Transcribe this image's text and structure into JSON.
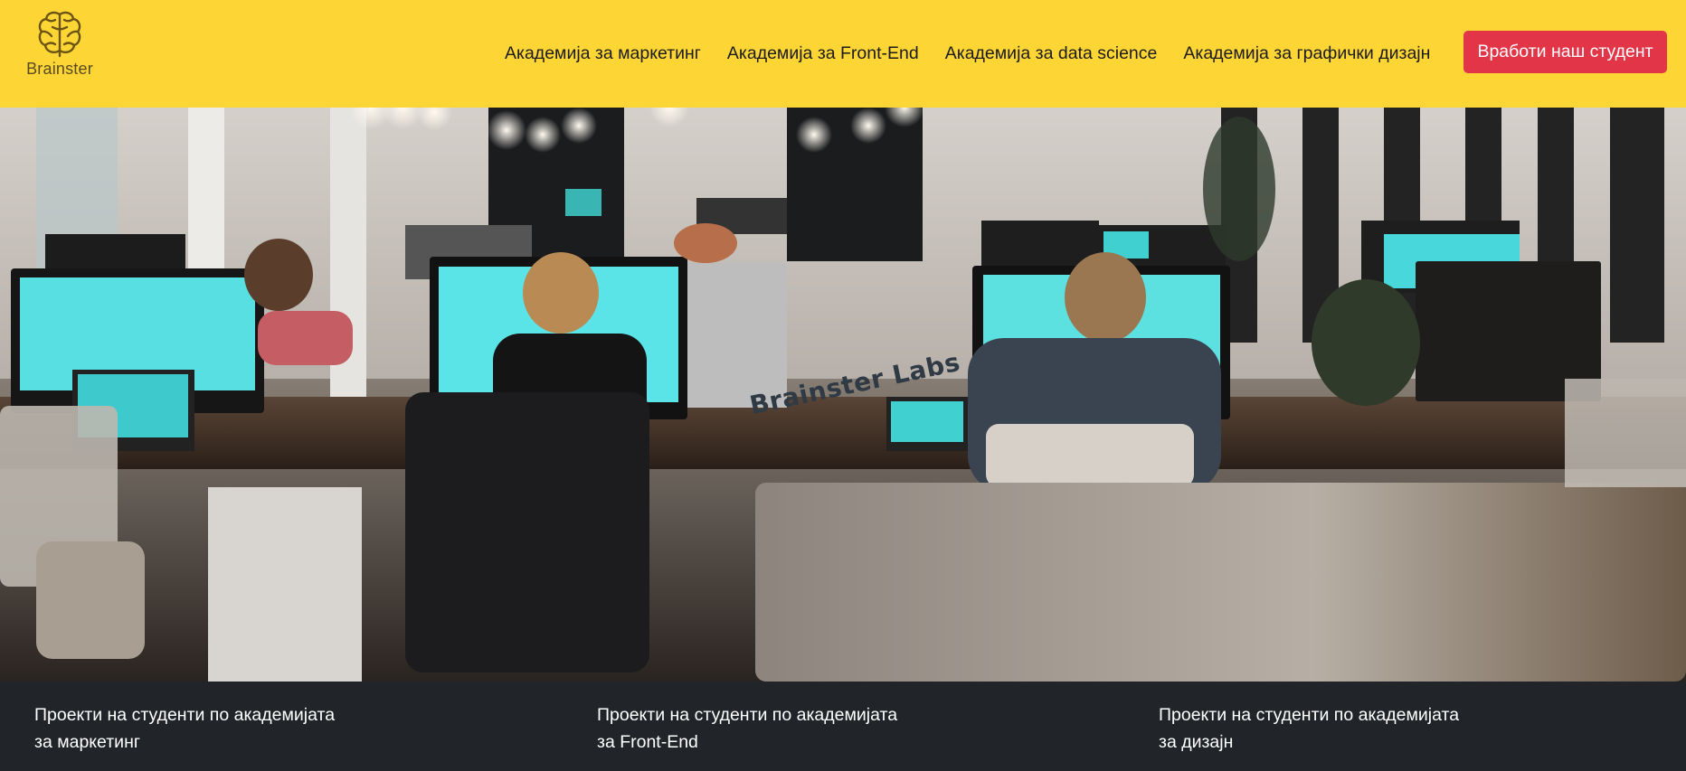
{
  "brand": {
    "name": "Brainster"
  },
  "nav": {
    "links": [
      {
        "label": "Академија за маркетинг"
      },
      {
        "label": "Академија за Front-End"
      },
      {
        "label": "Академија за data science"
      },
      {
        "label": "Академија за графички дизајн"
      }
    ],
    "cta_label": "Вработи наш студент"
  },
  "hero": {
    "caption": "Brainster Labs"
  },
  "projects": [
    {
      "line1": "Проекти на студенти по академијата",
      "line2": "за маркетинг"
    },
    {
      "line1": "Проекти на студенти по академијата",
      "line2": "за Front-End"
    },
    {
      "line1": "Проекти на студенти по академијата",
      "line2": "за дизајн"
    }
  ],
  "colors": {
    "header_bg": "#fdd636",
    "cta_bg": "#e23648",
    "footer_bg": "#212529"
  },
  "icons": [
    "brain-logo-icon"
  ]
}
